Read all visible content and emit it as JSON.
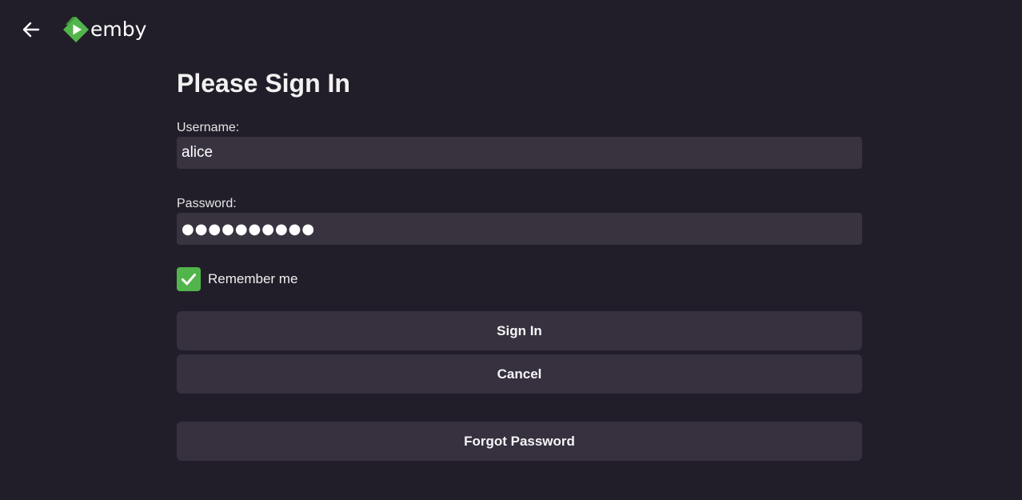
{
  "header": {
    "back_icon": "arrow-left-icon",
    "logo_icon": "emby-logo-icon",
    "logo_text": "emby",
    "logo_color": "#52b54b"
  },
  "form": {
    "title": "Please Sign In",
    "username": {
      "label": "Username:",
      "value": "alice"
    },
    "password": {
      "label": "Password:",
      "value": "●●●●●●●●●●"
    },
    "remember_me": {
      "label": "Remember me",
      "checked": true,
      "check_icon": "checkmark-icon",
      "color": "#52b54b"
    },
    "buttons": {
      "sign_in": "Sign In",
      "cancel": "Cancel",
      "forgot_password": "Forgot Password"
    }
  }
}
